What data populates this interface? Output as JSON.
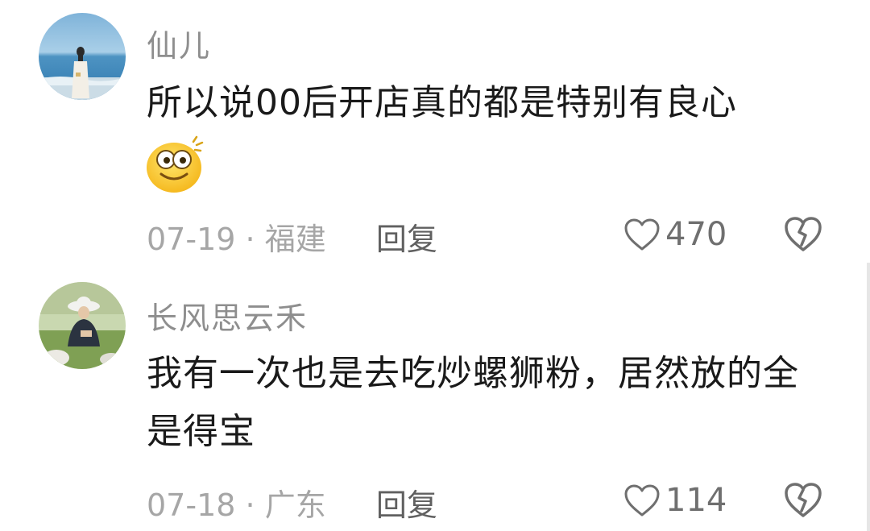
{
  "comments": [
    {
      "username": "仙儿",
      "text": "所以说00后开店真的都是特别有良心",
      "emoji": "dizzy-smile-emoji",
      "date": "07-19",
      "separator": "·",
      "location": "福建",
      "reply_label": "回复",
      "like_count": "470"
    },
    {
      "username": "长风思云禾",
      "text": "我有一次也是去吃炒螺狮粉，居然放的全是得宝",
      "date": "07-18",
      "separator": "·",
      "location": "广东",
      "reply_label": "回复",
      "like_count": "114"
    }
  ],
  "colors": {
    "username": "#8e8e8e",
    "text": "#1a1a1a",
    "meta": "#a6a6a6",
    "reply": "#606060",
    "icon": "#6f6f6f"
  },
  "icons": {
    "like": "heart-outline-icon",
    "dislike": "broken-heart-icon"
  }
}
